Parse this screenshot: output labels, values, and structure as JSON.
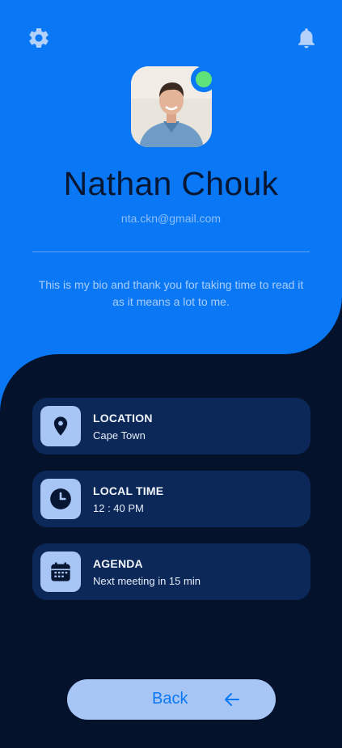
{
  "profile": {
    "name": "Nathan Chouk",
    "email": "nta.ckn@gmail.com",
    "bio": "This is my bio and thank you for taking time to read it as it means a lot to me.",
    "status": "online"
  },
  "cards": [
    {
      "title": "LOCATION",
      "value": "Cape Town",
      "icon": "location-pin-icon"
    },
    {
      "title": "LOCAL TIME",
      "value": "12 : 40 PM",
      "icon": "clock-icon"
    },
    {
      "title": "AGENDA",
      "value": "Next meeting in 15 min",
      "icon": "calendar-icon"
    }
  ],
  "back_button": {
    "label": "Back",
    "icon": "arrow-left-icon"
  },
  "header_icons": [
    "gear-icon",
    "bell-icon"
  ],
  "colors": {
    "primary": "#0a78f5",
    "background": "#04122c",
    "card": "#0c2859",
    "accent_light": "#a7c6f5",
    "status_online": "#5fe27a"
  }
}
